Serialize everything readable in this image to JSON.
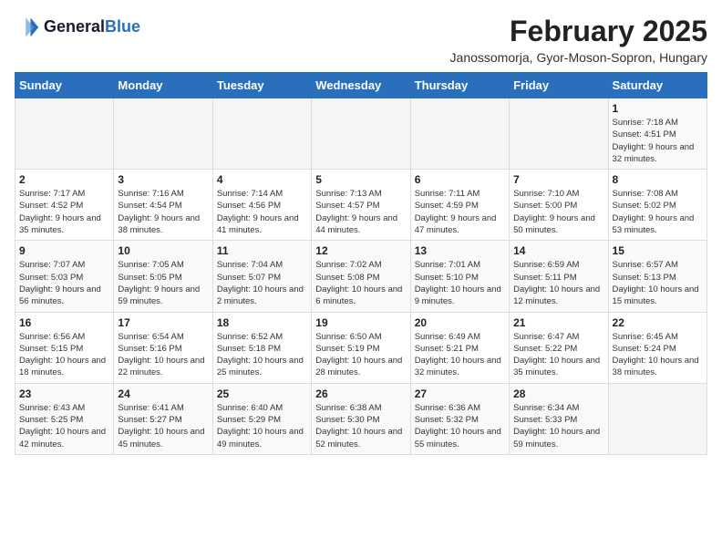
{
  "logo": {
    "line1": "General",
    "line2": "Blue"
  },
  "title": "February 2025",
  "subtitle": "Janossomorja, Gyor-Moson-Sopron, Hungary",
  "header_color": "#2a6fbc",
  "days_of_week": [
    "Sunday",
    "Monday",
    "Tuesday",
    "Wednesday",
    "Thursday",
    "Friday",
    "Saturday"
  ],
  "weeks": [
    [
      {
        "day": "",
        "detail": ""
      },
      {
        "day": "",
        "detail": ""
      },
      {
        "day": "",
        "detail": ""
      },
      {
        "day": "",
        "detail": ""
      },
      {
        "day": "",
        "detail": ""
      },
      {
        "day": "",
        "detail": ""
      },
      {
        "day": "1",
        "detail": "Sunrise: 7:18 AM\nSunset: 4:51 PM\nDaylight: 9 hours and 32 minutes."
      }
    ],
    [
      {
        "day": "2",
        "detail": "Sunrise: 7:17 AM\nSunset: 4:52 PM\nDaylight: 9 hours and 35 minutes."
      },
      {
        "day": "3",
        "detail": "Sunrise: 7:16 AM\nSunset: 4:54 PM\nDaylight: 9 hours and 38 minutes."
      },
      {
        "day": "4",
        "detail": "Sunrise: 7:14 AM\nSunset: 4:56 PM\nDaylight: 9 hours and 41 minutes."
      },
      {
        "day": "5",
        "detail": "Sunrise: 7:13 AM\nSunset: 4:57 PM\nDaylight: 9 hours and 44 minutes."
      },
      {
        "day": "6",
        "detail": "Sunrise: 7:11 AM\nSunset: 4:59 PM\nDaylight: 9 hours and 47 minutes."
      },
      {
        "day": "7",
        "detail": "Sunrise: 7:10 AM\nSunset: 5:00 PM\nDaylight: 9 hours and 50 minutes."
      },
      {
        "day": "8",
        "detail": "Sunrise: 7:08 AM\nSunset: 5:02 PM\nDaylight: 9 hours and 53 minutes."
      }
    ],
    [
      {
        "day": "9",
        "detail": "Sunrise: 7:07 AM\nSunset: 5:03 PM\nDaylight: 9 hours and 56 minutes."
      },
      {
        "day": "10",
        "detail": "Sunrise: 7:05 AM\nSunset: 5:05 PM\nDaylight: 9 hours and 59 minutes."
      },
      {
        "day": "11",
        "detail": "Sunrise: 7:04 AM\nSunset: 5:07 PM\nDaylight: 10 hours and 2 minutes."
      },
      {
        "day": "12",
        "detail": "Sunrise: 7:02 AM\nSunset: 5:08 PM\nDaylight: 10 hours and 6 minutes."
      },
      {
        "day": "13",
        "detail": "Sunrise: 7:01 AM\nSunset: 5:10 PM\nDaylight: 10 hours and 9 minutes."
      },
      {
        "day": "14",
        "detail": "Sunrise: 6:59 AM\nSunset: 5:11 PM\nDaylight: 10 hours and 12 minutes."
      },
      {
        "day": "15",
        "detail": "Sunrise: 6:57 AM\nSunset: 5:13 PM\nDaylight: 10 hours and 15 minutes."
      }
    ],
    [
      {
        "day": "16",
        "detail": "Sunrise: 6:56 AM\nSunset: 5:15 PM\nDaylight: 10 hours and 18 minutes."
      },
      {
        "day": "17",
        "detail": "Sunrise: 6:54 AM\nSunset: 5:16 PM\nDaylight: 10 hours and 22 minutes."
      },
      {
        "day": "18",
        "detail": "Sunrise: 6:52 AM\nSunset: 5:18 PM\nDaylight: 10 hours and 25 minutes."
      },
      {
        "day": "19",
        "detail": "Sunrise: 6:50 AM\nSunset: 5:19 PM\nDaylight: 10 hours and 28 minutes."
      },
      {
        "day": "20",
        "detail": "Sunrise: 6:49 AM\nSunset: 5:21 PM\nDaylight: 10 hours and 32 minutes."
      },
      {
        "day": "21",
        "detail": "Sunrise: 6:47 AM\nSunset: 5:22 PM\nDaylight: 10 hours and 35 minutes."
      },
      {
        "day": "22",
        "detail": "Sunrise: 6:45 AM\nSunset: 5:24 PM\nDaylight: 10 hours and 38 minutes."
      }
    ],
    [
      {
        "day": "23",
        "detail": "Sunrise: 6:43 AM\nSunset: 5:25 PM\nDaylight: 10 hours and 42 minutes."
      },
      {
        "day": "24",
        "detail": "Sunrise: 6:41 AM\nSunset: 5:27 PM\nDaylight: 10 hours and 45 minutes."
      },
      {
        "day": "25",
        "detail": "Sunrise: 6:40 AM\nSunset: 5:29 PM\nDaylight: 10 hours and 49 minutes."
      },
      {
        "day": "26",
        "detail": "Sunrise: 6:38 AM\nSunset: 5:30 PM\nDaylight: 10 hours and 52 minutes."
      },
      {
        "day": "27",
        "detail": "Sunrise: 6:36 AM\nSunset: 5:32 PM\nDaylight: 10 hours and 55 minutes."
      },
      {
        "day": "28",
        "detail": "Sunrise: 6:34 AM\nSunset: 5:33 PM\nDaylight: 10 hours and 59 minutes."
      },
      {
        "day": "",
        "detail": ""
      }
    ]
  ]
}
